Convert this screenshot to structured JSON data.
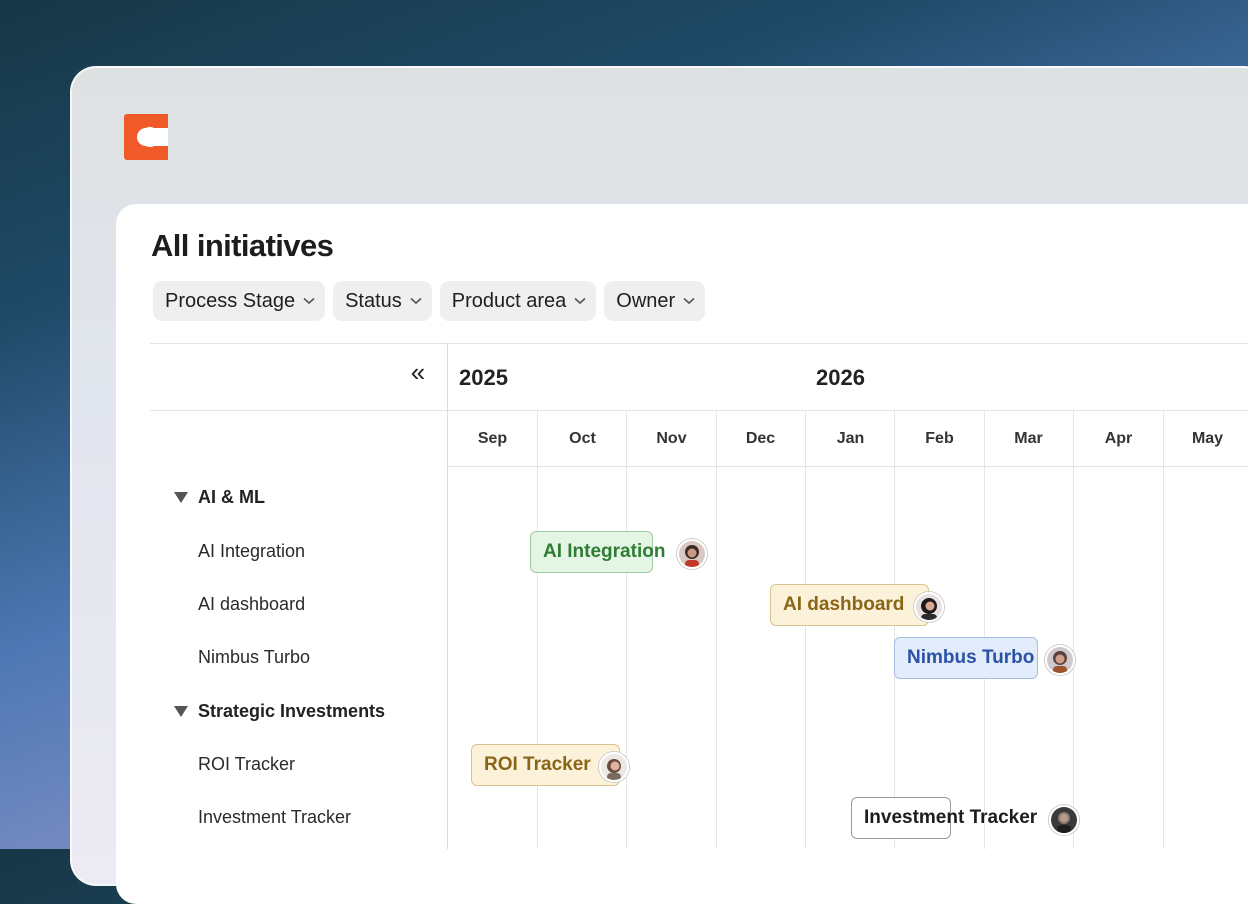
{
  "header": {
    "title": "All initiatives"
  },
  "filters": [
    {
      "label": "Process Stage"
    },
    {
      "label": "Status"
    },
    {
      "label": "Product area"
    },
    {
      "label": "Owner"
    }
  ],
  "timeline": {
    "collapse_glyph": "«",
    "years": [
      "2025",
      "2026"
    ],
    "months": [
      "Sep",
      "Oct",
      "Nov",
      "Dec",
      "Jan",
      "Feb",
      "Mar",
      "Apr",
      "May"
    ]
  },
  "groups": [
    {
      "label": "AI & ML",
      "items": [
        "AI Integration",
        "AI dashboard",
        "Nimbus Turbo"
      ]
    },
    {
      "label": "Strategic Investments",
      "items": [
        "ROI Tracker",
        "Investment Tracker"
      ]
    }
  ],
  "bars": [
    {
      "label": "AI Integration",
      "color": "#2e7d32",
      "bg": "#e4f5e6",
      "border": "#9ccca2"
    },
    {
      "label": "AI dashboard",
      "color": "#8a6518",
      "bg": "#fbf2d9",
      "border": "#d8c48f"
    },
    {
      "label": "Nimbus Turbo",
      "color": "#2a52a8",
      "bg": "#e3ecfa",
      "border": "#a9bde3"
    },
    {
      "label": "ROI Tracker",
      "color": "#8a6518",
      "bg": "#fbf2d9",
      "border": "#d8c48f"
    },
    {
      "label": "Investment Tracker",
      "color": "#1d1d1d",
      "bg": "#ffffff",
      "border": "#9a9a9a"
    }
  ],
  "colors": {
    "brand": "#f05a28",
    "accent_dark": "#1d1d1f"
  }
}
